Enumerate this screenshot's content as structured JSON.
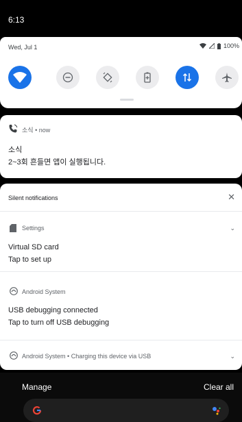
{
  "status_bar": {
    "time": "6:13"
  },
  "quick_settings": {
    "date": "Wed, Jul 1",
    "battery_text": "100%",
    "tiles": [
      {
        "name": "wifi",
        "active": true
      },
      {
        "name": "do-not-disturb",
        "active": false
      },
      {
        "name": "auto-rotate",
        "active": false
      },
      {
        "name": "battery-saver",
        "active": false
      },
      {
        "name": "mobile-data",
        "active": true
      },
      {
        "name": "airplane-mode",
        "active": false
      }
    ]
  },
  "notification": {
    "app": "소식",
    "time": "now",
    "title": "소식",
    "body": "2~3회 흔들면 앱이 실행됩니다."
  },
  "silent": {
    "header": "Silent notifications",
    "settings": {
      "app": "Settings",
      "title": "Virtual SD card",
      "body": "Tap to set up"
    },
    "android_usb": {
      "app": "Android System",
      "title": "USB debugging connected",
      "body": "Tap to turn off USB debugging"
    },
    "android_charging": {
      "app": "Android System",
      "summary": "Charging this device via USB"
    }
  },
  "footer": {
    "manage": "Manage",
    "clear_all": "Clear all"
  },
  "colors": {
    "accent": "#1a73e8"
  }
}
